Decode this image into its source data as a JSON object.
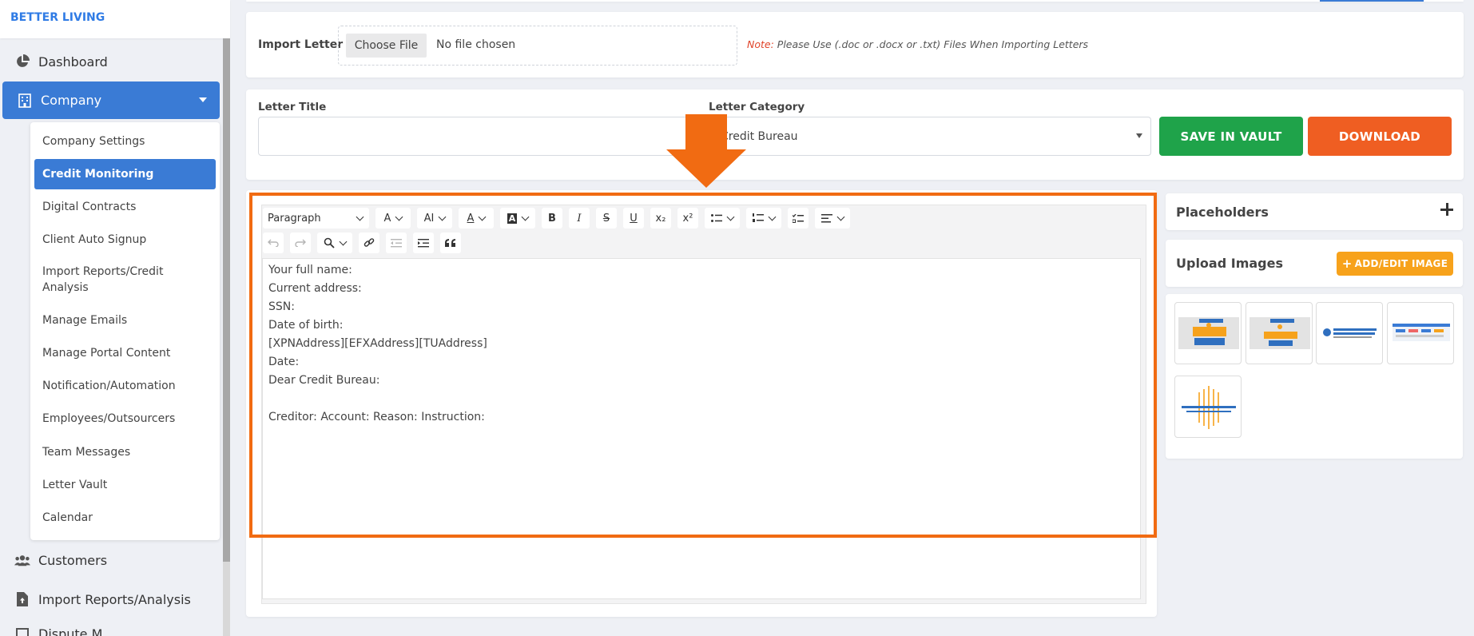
{
  "brand": "BETTER LIVING",
  "sidebar": {
    "items": {
      "dashboard": "Dashboard",
      "company": "Company",
      "customers": "Customers",
      "import_reports": "Import Reports/Analysis",
      "dispute_cut": "Dispute M..."
    },
    "submenu": [
      "Company Settings",
      "Credit Monitoring",
      "Digital Contracts",
      "Client Auto Signup",
      "Import Reports/Credit Analysis",
      "Manage Emails",
      "Manage Portal Content",
      "Notification/Automation",
      "Employees/Outsourcers",
      "Team Messages",
      "Letter Vault",
      "Calendar"
    ],
    "active_submenu": "Credit Monitoring"
  },
  "import": {
    "label": "Import Letter",
    "choose_button": "Choose File",
    "file_status": "No file chosen",
    "note_prefix": "Note:",
    "note_text": "Please Use (.doc or .docx or .txt) Files When Importing Letters"
  },
  "letter": {
    "title_label": "Letter Title",
    "title_value": "",
    "category_label": "Letter Category",
    "category_value": "Credit Bureau",
    "save_button": "SAVE IN VAULT",
    "download_button": "DOWNLOAD"
  },
  "toolbar": {
    "paragraph": "Paragraph",
    "font_size": "A⁲",
    "font_family": "AI",
    "bold": "B",
    "italic": "I",
    "strike": "S",
    "underline": "U",
    "subscript": "x₂",
    "superscript": "x²"
  },
  "editor_lines": [
    "Your full name:",
    "Current address:",
    "SSN:",
    "Date of birth:",
    "[XPNAddress][EFXAddress][TUAddress]",
    "Date:",
    "Dear Credit Bureau:",
    "",
    "Creditor: Account: Reason: Instruction:"
  ],
  "right_panel": {
    "placeholders_title": "Placeholders",
    "upload_title": "Upload Images",
    "add_edit_button": "ADD/EDIT IMAGE",
    "thumbnails": [
      "sending-out-your-first-dispute",
      "automated-recurring-billing",
      "startup-credit-repair-business",
      "dashboard-screenshot",
      "client-dispute-manager"
    ]
  },
  "colors": {
    "primary": "#3a7bd5",
    "save": "#1fa34a",
    "download": "#ef5e22",
    "add_edit": "#f7a21b",
    "highlight": "#f16b12",
    "note_red": "#e0442a"
  }
}
